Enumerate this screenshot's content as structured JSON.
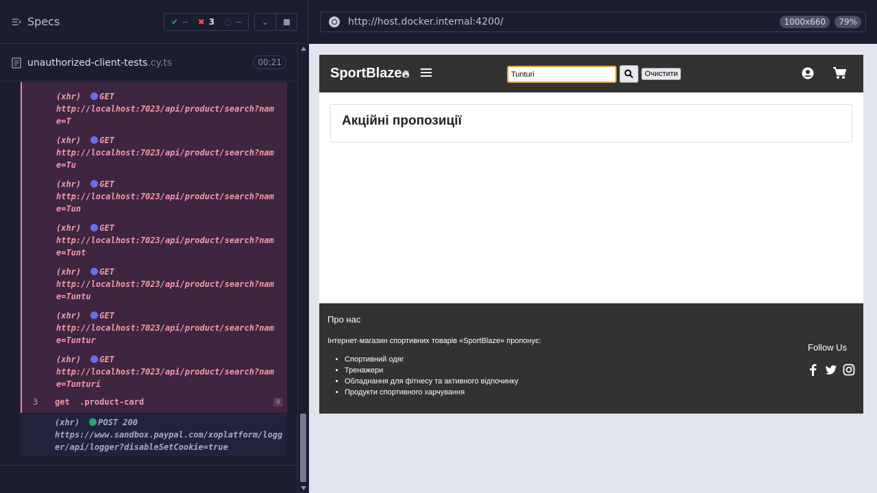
{
  "runner": {
    "title": "Specs",
    "stats": {
      "passed": "--",
      "failed": "3",
      "pending": "--"
    },
    "spec": {
      "name": "unauthorized-client-tests",
      "ext": ".cy.ts",
      "time": "00:21"
    },
    "log_entries": [
      {
        "type": "(xhr)",
        "method": "GET",
        "url": "http://localhost:7023/api/product/search?name=T"
      },
      {
        "type": "(xhr)",
        "method": "GET",
        "url": "http://localhost:7023/api/product/search?name=Tu"
      },
      {
        "type": "(xhr)",
        "method": "GET",
        "url": "http://localhost:7023/api/product/search?name=Tun"
      },
      {
        "type": "(xhr)",
        "method": "GET",
        "url": "http://localhost:7023/api/product/search?name=Tunt"
      },
      {
        "type": "(xhr)",
        "method": "GET",
        "url": "http://localhost:7023/api/product/search?name=Tuntu"
      },
      {
        "type": "(xhr)",
        "method": "GET",
        "url": "http://localhost:7023/api/product/search?name=Tuntur"
      },
      {
        "type": "(xhr)",
        "method": "GET",
        "url": "http://localhost:7023/api/product/search?name=Tunturi"
      }
    ],
    "command": {
      "num": "3",
      "text": "get  .product-card",
      "badge": "0"
    },
    "post": {
      "type": "(xhr)",
      "method": "POST 200",
      "url": "https://www.sandbox.paypal.com/xoplatform/logger/api/logger?disableSetCookie=true"
    }
  },
  "browser": {
    "url": "http://host.docker.internal:4200/",
    "viewport": "1000x660",
    "zoom": "79%"
  },
  "app": {
    "logo": "SportBlaze",
    "search_value": "Tunturi",
    "clear_label": "Очистити",
    "promo_title": "Акційні пропозиції",
    "footer": {
      "title": "Про нас",
      "desc": "Інтернет-магазин спортивних товарів «SportBlaze» пропонує:",
      "items": [
        "Спортивний одяг",
        "Тренажери",
        "Обладнання для фітнесу та активного відпочинку",
        "Продукти спортивного харчування"
      ],
      "follow": "Follow Us"
    }
  }
}
